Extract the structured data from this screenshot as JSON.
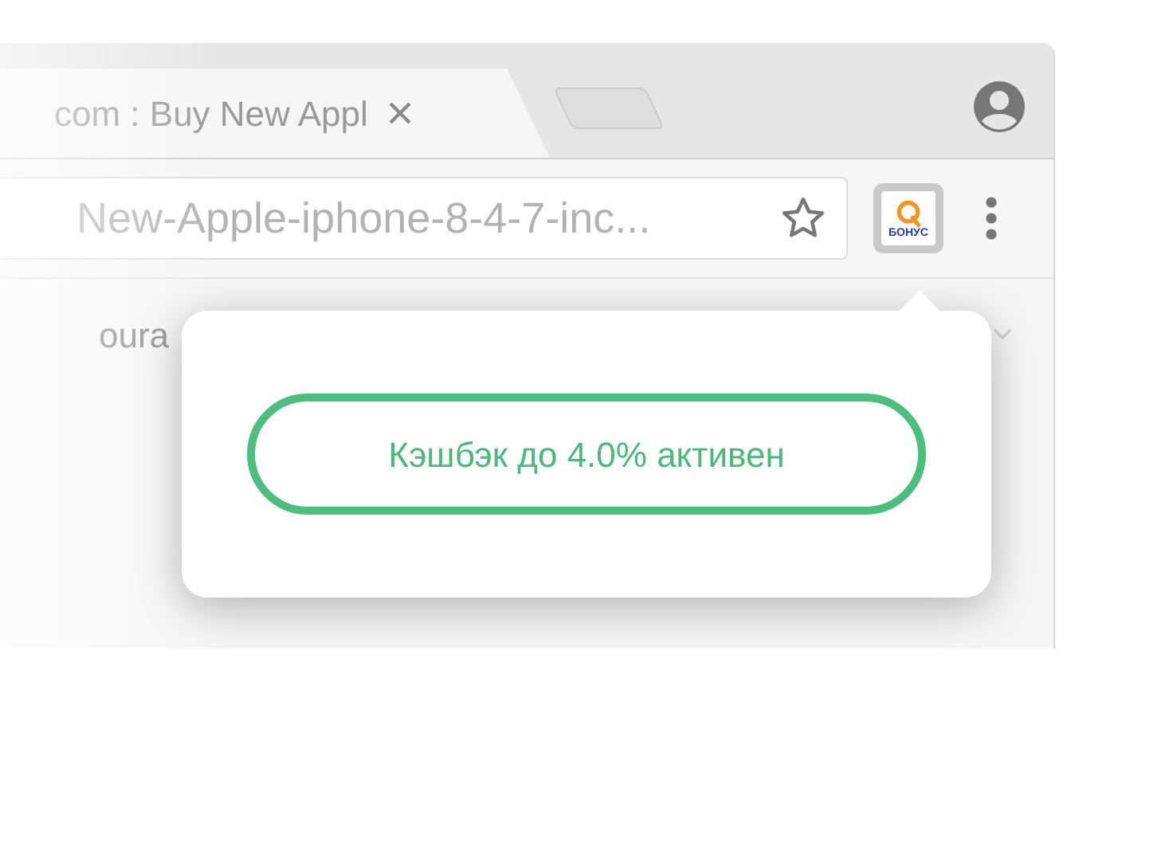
{
  "tabs": [
    {
      "title": "com : Buy New Appl",
      "selected": true
    }
  ],
  "address_bar": {
    "url": "New-Apple-iphone-8-4-7-inc..."
  },
  "extension": {
    "label": "БОНУС"
  },
  "bookmarks_bar": {
    "text": "oura"
  },
  "popup": {
    "status": "Кэшбэк до 4.0% активен",
    "active": true
  }
}
